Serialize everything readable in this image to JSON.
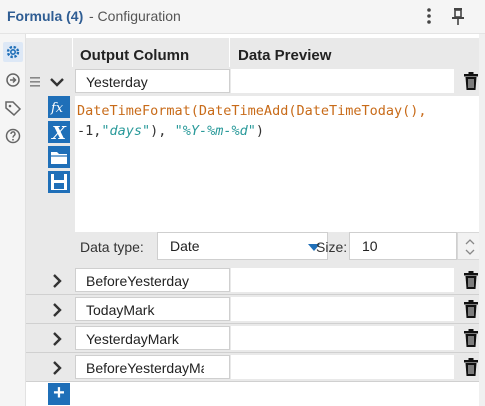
{
  "window": {
    "title": "Formula (4)",
    "subtitle": "- Configuration",
    "menu_icon": "kebab-menu-icon",
    "pin_icon": "pin-icon"
  },
  "left_toolbar": {
    "items": [
      {
        "icon": "gear-icon",
        "active": true
      },
      {
        "icon": "connection-icon",
        "active": false
      },
      {
        "icon": "tag-icon",
        "active": false
      },
      {
        "icon": "help-icon",
        "active": false
      }
    ]
  },
  "grid": {
    "headers": {
      "output_column": "Output Column",
      "data_preview": "Data Preview"
    },
    "expanded_row": {
      "name": "Yesterday",
      "expression_line1_parts": [
        "DateTimeFormat(DateTimeAdd(DateTimeToday(),",
        ""
      ],
      "expression": {
        "l1_fn": "DateTimeFormat(DateTimeAdd(DateTimeToday(),",
        "l2_a": "-1,",
        "l2_str1": "\"days\"",
        "l2_b": "), ",
        "l2_str2": "\"%Y-%m-%d\"",
        "l2_c": ")"
      },
      "data_type_label": "Data type:",
      "data_type_value": "Date",
      "size_label": "Size:",
      "size_value": "10"
    },
    "rows": [
      {
        "name": "BeforeYesterday"
      },
      {
        "name": "TodayMark"
      },
      {
        "name": "YesterdayMark"
      },
      {
        "name": "BeforeYesterdayMark"
      }
    ],
    "tool_icons": [
      "function-icon",
      "variable-icon",
      "open-folder-icon",
      "save-icon"
    ],
    "add_label": "+"
  },
  "colors": {
    "accent": "#1f6fb8",
    "function_text": "#c86b19",
    "string_text": "#2a9a9a",
    "title": "#2f5d93"
  }
}
